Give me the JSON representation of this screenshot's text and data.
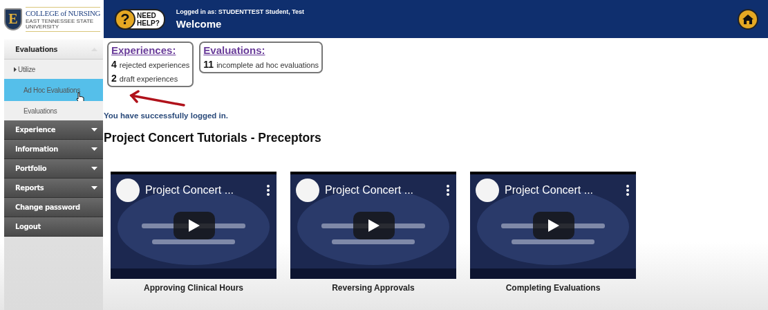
{
  "header": {
    "logo": {
      "title": "COLLEGE of NURSING",
      "subtitle": "EAST TENNESSEE STATE UNIVERSITY",
      "emblem": "E"
    },
    "help": {
      "symbol": "?",
      "label_1": "NEED",
      "label_2": "HELP?"
    },
    "logged_in": "Logged in as:  STUDENTTEST Student, Test",
    "title": "Welcome"
  },
  "sidebar": {
    "items": [
      {
        "label": "Evaluations",
        "expanded": true,
        "children": [
          {
            "label": "Utilize",
            "kind": "group",
            "selected": false
          },
          {
            "label": "Ad Hoc Evaluations",
            "kind": "link",
            "selected": true
          },
          {
            "label": "Evaluations",
            "kind": "link",
            "selected": false
          }
        ]
      },
      {
        "label": "Experience",
        "expanded": false,
        "has_menu": true
      },
      {
        "label": "Information",
        "expanded": false,
        "has_menu": true
      },
      {
        "label": "Portfolio",
        "expanded": false,
        "has_menu": true
      },
      {
        "label": "Reports",
        "expanded": false,
        "has_menu": true
      },
      {
        "label": "Change password",
        "expanded": false,
        "has_menu": false
      },
      {
        "label": "Logout",
        "expanded": false,
        "has_menu": false
      }
    ]
  },
  "summary": [
    {
      "title": "Experiences:",
      "entries": [
        {
          "count": "4",
          "label": "rejected experiences"
        },
        {
          "count": "2",
          "label": "draft experiences"
        }
      ]
    },
    {
      "title": "Evaluations:",
      "entries": [
        {
          "count": "11",
          "label": "incomplete ad hoc evaluations"
        }
      ]
    }
  ],
  "message": "You have successfully logged in.",
  "heading": "Project Concert Tutorials - Preceptors",
  "videos": [
    {
      "overlay_title": "Project Concert ...",
      "caption": "Approving Clinical Hours"
    },
    {
      "overlay_title": "Project Concert ...",
      "caption": "Reversing Approvals"
    },
    {
      "overlay_title": "Project Concert ...",
      "caption": "Completing Evaluations"
    }
  ]
}
